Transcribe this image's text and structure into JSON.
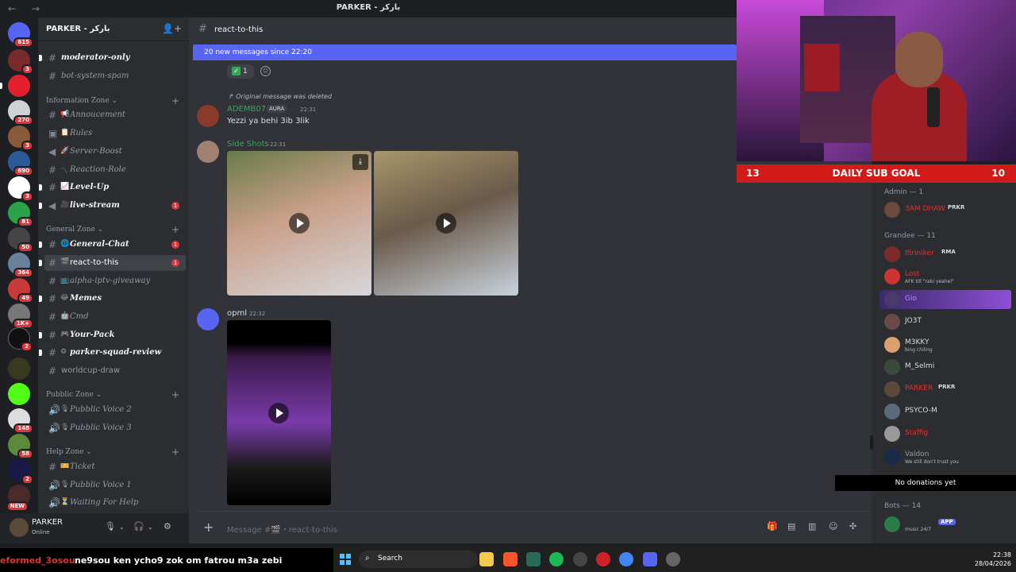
{
  "window": {
    "title": "PARKER - باركر",
    "nav": "←  →"
  },
  "guild": {
    "name": "PARKER - باركر"
  },
  "servers": [
    {
      "badge": "615"
    },
    {
      "badge": "3"
    },
    {
      "badge": ""
    },
    {
      "badge": "270"
    },
    {
      "badge": "3"
    },
    {
      "badge": "690"
    },
    {
      "badge": "3"
    },
    {
      "badge": "81"
    },
    {
      "badge": "50"
    },
    {
      "badge": "364"
    },
    {
      "badge": "49"
    },
    {
      "badge": "1K+"
    },
    {
      "badge": "2"
    },
    {
      "badge": ""
    },
    {
      "badge": ""
    },
    {
      "badge": "148"
    },
    {
      "badge": "58"
    },
    {
      "badge": "2"
    },
    {
      "badge": "NEW"
    }
  ],
  "channels": [
    {
      "name": "moderator-only",
      "emoji": "",
      "ping": ""
    },
    {
      "name": "bot-system-spam",
      "emoji": "",
      "ping": ""
    },
    {
      "name": "Annoucement",
      "emoji": "📢",
      "ping": ""
    },
    {
      "name": "Rules",
      "emoji": "📋",
      "ping": ""
    },
    {
      "name": "Server-Boost",
      "emoji": "🚀",
      "ping": ""
    },
    {
      "name": "Reaction-Role",
      "emoji": "〽",
      "ping": ""
    },
    {
      "name": "Level-Up",
      "emoji": "📈",
      "ping": ""
    },
    {
      "name": "live-stream",
      "emoji": "🎥",
      "ping": "1"
    },
    {
      "name": "General-Chat",
      "emoji": "🌐",
      "ping": "1"
    },
    {
      "name": "react-to-this",
      "emoji": "🎬",
      "ping": "1"
    },
    {
      "name": "alpha-iptv-giveaway",
      "emoji": "📺",
      "ping": ""
    },
    {
      "name": "Memes",
      "emoji": "😂",
      "ping": ""
    },
    {
      "name": "Cmd",
      "emoji": "🤖",
      "ping": ""
    },
    {
      "name": "Your-Pack",
      "emoji": "🎮",
      "ping": ""
    },
    {
      "name": "parker-squad-review",
      "emoji": "⚙",
      "ping": ""
    },
    {
      "name": "worldcup-draw",
      "emoji": "",
      "ping": ""
    },
    {
      "name": "Pubblic Voice 2",
      "emoji": "🎙",
      "ping": ""
    },
    {
      "name": "Pubblic Voice 3",
      "emoji": "🎙",
      "ping": ""
    },
    {
      "name": "Ticket",
      "emoji": "🎫",
      "ping": ""
    },
    {
      "name": "Pubblic Voice 1",
      "emoji": "🎙",
      "ping": ""
    },
    {
      "name": "Waiting For Help",
      "emoji": "⏳",
      "ping": ""
    }
  ],
  "categories": [
    "Information Zone",
    "General Zone",
    "Pubblic Zone",
    "Help Zone"
  ],
  "user": {
    "name": "PARKER",
    "status": "Online"
  },
  "channel_header": {
    "name": "react-to-this"
  },
  "new_messages": "20 new messages since 22:20",
  "reaction": {
    "count": "1"
  },
  "messages": [
    {
      "reply": "Original message was deleted",
      "author": "ADEMB07",
      "tag": "AURA",
      "time": "22:31",
      "text": "Yezzi ya behi 3ib 3lik"
    },
    {
      "author": "Side Shots",
      "time": "22:31"
    },
    {
      "author": "opml",
      "time": "22:32"
    }
  ],
  "composer": {
    "placeholder": "Message #🎬・react-to-this"
  },
  "overlay": {
    "goal_left": "13",
    "goal_title": "DAILY SUB GOAL",
    "goal_right": "10",
    "donations": "No donations yet"
  },
  "members": {
    "admin_header": "Admin — 1",
    "grandee_header": "Grandee — 11",
    "bots_header": "Bots — 14",
    "admin": [
      {
        "name": "3AM DHAW",
        "tag": "PRKR"
      }
    ],
    "grandee": [
      {
        "name": "Ifiriniker",
        "tag": "RMA",
        "status": ""
      },
      {
        "name": "Lost",
        "tag": "",
        "status": "AFK till \"rabi yeahel\""
      },
      {
        "name": "Gio",
        "tag": "",
        "status": ""
      },
      {
        "name": "JO3T",
        "tag": "",
        "status": ""
      },
      {
        "name": "M3KKY",
        "tag": "",
        "status": "bing chiling"
      },
      {
        "name": "M_Selmi",
        "tag": "",
        "status": ""
      },
      {
        "name": "PARKER",
        "tag": "PRKR",
        "status": ""
      },
      {
        "name": "PSYCO-M",
        "tag": "",
        "status": ""
      },
      {
        "name": "Staffig",
        "tag": "",
        "status": ""
      },
      {
        "name": "Valdon",
        "tag": "",
        "status": "We still don't trust you"
      }
    ],
    "bots": [
      {
        "name": "",
        "tag": "APP",
        "status": "music 24/7"
      }
    ]
  },
  "ticker": {
    "user": "eformed_3osou",
    "message": "ne9sou ken ycho9 zok om fatrou m3a zebi"
  },
  "taskbar": {
    "search": "Search",
    "time": "22:38",
    "date": "28/04/2026"
  },
  "colors": {
    "accent": "#5865f2",
    "goal": "#d11a1a",
    "mention": "#da373c"
  }
}
